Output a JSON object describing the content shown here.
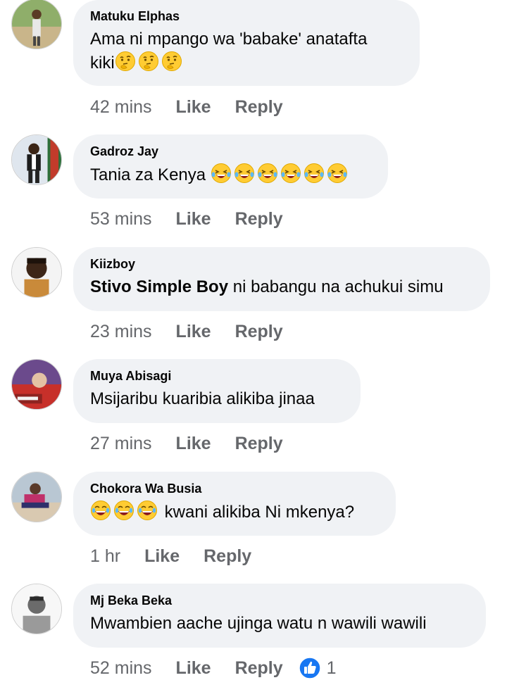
{
  "comments": [
    {
      "author": "Matuku Elphas",
      "text": "Ama ni mpango wa 'babake' anatafta",
      "text2": "kiki",
      "time": "42 mins",
      "like": "Like",
      "reply": "Reply",
      "emoji": "thinking-face"
    },
    {
      "author": "Gadroz Jay",
      "text": "Tania za Kenya",
      "time": "53 mins",
      "like": "Like",
      "reply": "Reply",
      "emoji": "rolling-on-floor-laughing"
    },
    {
      "author": "Kiizboy",
      "mention": "Stivo Simple Boy",
      "text": " ni babangu na achukui simu",
      "time": "23 mins",
      "like": "Like",
      "reply": "Reply"
    },
    {
      "author": "Muya Abisagi",
      "text": "Msijaribu kuaribia alikiba jinaa",
      "time": "27 mins",
      "like": "Like",
      "reply": "Reply"
    },
    {
      "author": "Chokora Wa Busia",
      "text": "kwani alikiba Ni mkenya?",
      "time": "1 hr",
      "like": "Like",
      "reply": "Reply",
      "emoji": "face-with-tears-of-joy"
    },
    {
      "author": "Mj Beka Beka",
      "text": "Mwambien aache ujinga watu n wawili wawili",
      "time": "52 mins",
      "like": "Like",
      "reply": "Reply",
      "reaction_count": "1",
      "reaction_icon": "like-thumb-icon"
    }
  ],
  "colors": {
    "bubble": "#f0f2f5",
    "meta": "#65676b",
    "like_blue": "#1877f2"
  }
}
